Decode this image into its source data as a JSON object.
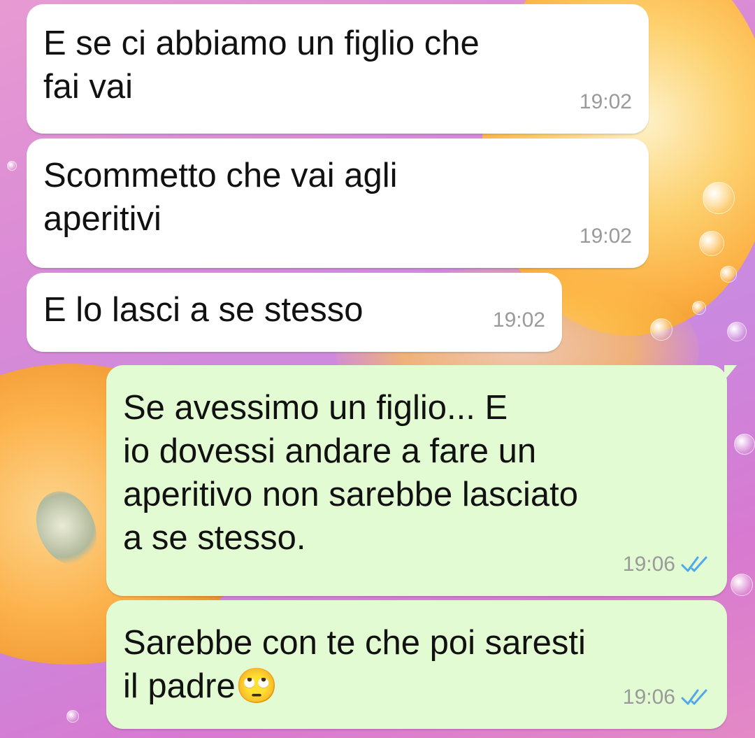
{
  "messages": [
    {
      "direction": "incoming",
      "text": "E se ci abbiamo un figlio che\nfai vai",
      "time": "19:02"
    },
    {
      "direction": "incoming",
      "text": "Scommetto che vai agli\naperitivi",
      "time": "19:02"
    },
    {
      "direction": "incoming",
      "text": "E lo lasci a se stesso",
      "time": "19:02"
    },
    {
      "direction": "outgoing",
      "text": "Se avessimo un figlio... E\nio dovessi andare a fare un\naperitivo non sarebbe lasciato\na se stesso.",
      "time": "19:06",
      "status": "read"
    },
    {
      "direction": "outgoing",
      "text": "Sarebbe con te che poi saresti\nil padre🙄",
      "time": "19:06",
      "status": "read"
    }
  ],
  "colors": {
    "incoming_bubble": "#ffffff",
    "outgoing_bubble": "#e2fbd3",
    "read_ticks": "#4fa8ea",
    "timestamp": "#9a9a9a"
  },
  "icons": {
    "read_receipt": "double-check-icon"
  }
}
